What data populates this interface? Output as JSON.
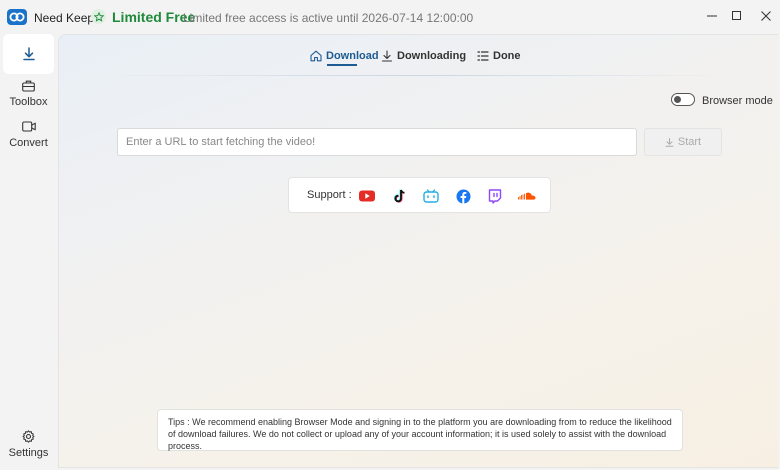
{
  "app": {
    "name": "Need Keep"
  },
  "license": {
    "badge": "Limited Free",
    "note": "Limited free access is active until 2026-07-14 12:00:00"
  },
  "sidebar": {
    "items": [
      {
        "label": "",
        "icon": "download-icon",
        "active": true
      },
      {
        "label": "Toolbox",
        "icon": "toolbox-icon"
      },
      {
        "label": "Convert",
        "icon": "video-icon"
      },
      {
        "label": "Settings",
        "icon": "gear-icon"
      }
    ]
  },
  "tabs": [
    {
      "label": "Download",
      "icon": "home-icon",
      "active": true
    },
    {
      "label": "Downloading",
      "icon": "download-arrow-icon"
    },
    {
      "label": "Done",
      "icon": "list-icon"
    }
  ],
  "browser_mode": {
    "label": "Browser mode",
    "enabled": false
  },
  "url_input": {
    "placeholder": "Enter a URL to start fetching the video!",
    "value": ""
  },
  "start_button": {
    "label": "Start",
    "enabled": false
  },
  "support": {
    "label": "Support :",
    "platforms": [
      "youtube-icon",
      "tiktok-icon",
      "bilibili-icon",
      "facebook-icon",
      "twitch-icon",
      "soundcloud-icon"
    ]
  },
  "tips": {
    "text": "Tips : We recommend enabling Browser Mode and signing in to the platform you are downloading from to reduce the likelihood of download failures. We do not collect or upload any of your account information; it is used solely to assist with the download process."
  },
  "colors": {
    "accent": "#1d5b92",
    "brand": "#1f8a3b",
    "logo": "#1a73c9"
  }
}
